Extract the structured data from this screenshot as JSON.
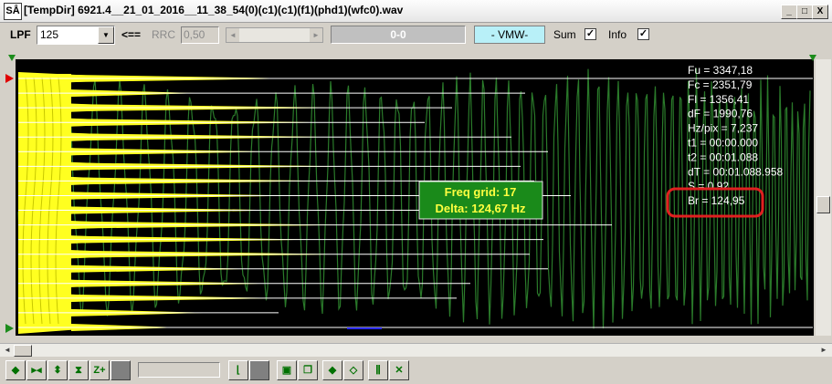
{
  "window": {
    "icon_text": "SÅ",
    "title": "[TempDir] 6921.4__21_01_2016__11_38_54(0)(c1)(c1)(f1)(phd1)(wfc0).wav",
    "min_label": "_",
    "max_label": "□",
    "close_label": "X"
  },
  "toolbar": {
    "lpf_label": "LPF",
    "lpf_value": "125",
    "back_label": "<==",
    "rrc_label": "RRC",
    "rrc_value": "0,50",
    "readout": "0-0",
    "mode": "- VMW-",
    "sum_label": "Sum",
    "sum_checked": true,
    "info_label": "Info",
    "info_checked": true
  },
  "plot": {
    "info_lines": [
      "Fu = 3347,18",
      "Fc = 2351,79",
      "Fl = 1356,41",
      "dF = 1990,76",
      "Hz/pix = 7,237",
      "t1 = 00:00.000",
      "t2 = 00:01.088",
      "dT = 00:01.088.958",
      "S = 0.92",
      "Br = 124,95"
    ],
    "tooltip_line1": "Freq grid: 17",
    "tooltip_line2": "Delta: 124,67 Hz",
    "colors": {
      "background": "#000000",
      "spectrum": "#ffff20",
      "waveform": "#2a7a2a",
      "gridline": "#ffffff",
      "highlight": "#e02020",
      "tooltip_bg": "#1a8a1a",
      "tooltip_text": "#ffff40"
    }
  },
  "bottombar": {
    "buttons": [
      "move-horizontal-icon",
      "fit-horizontal-icon",
      "move-vertical-icon",
      "fit-vertical-icon",
      "zoom-plus-icon",
      "blank-button-icon",
      "step-icon",
      "stop-icon",
      "save-image-icon",
      "copy-icon",
      "diamond-icon",
      "diamond-outline-icon",
      "equalizer-icon",
      "cross-arrows-icon"
    ]
  }
}
